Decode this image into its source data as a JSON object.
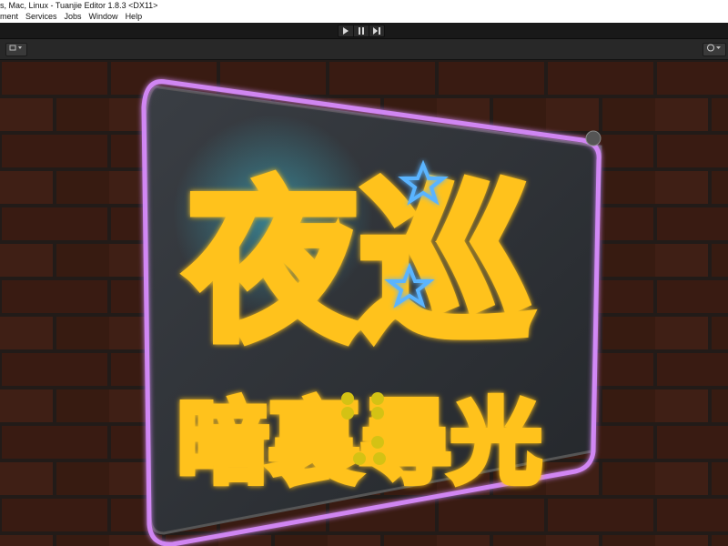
{
  "window": {
    "title": "s, Mac, Linux - Tuanjie Editor 1.8.3 <DX11>"
  },
  "menu": {
    "items": [
      "ment",
      "Services",
      "Jobs",
      "Window",
      "Help"
    ]
  },
  "toolbar": {
    "play_icon": "play-icon",
    "pause_icon": "pause-icon",
    "step_icon": "step-icon"
  },
  "scene": {
    "sign_title": "夜巡",
    "sign_subtitle": "暗裏尋光",
    "colors": {
      "neon_yellow": "#ffc21a",
      "neon_purple": "#d98cff",
      "neon_blue": "#5ab4ff",
      "brick": "#5a2a1e",
      "mortar": "#2a2420"
    }
  }
}
